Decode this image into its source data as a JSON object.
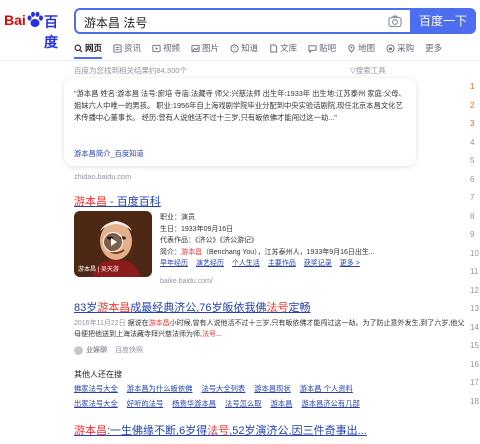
{
  "header": {
    "logo_left": "Bai",
    "logo_right": "百度",
    "query": "游本昌 法号",
    "search_button": "百度一下"
  },
  "tabs": [
    {
      "label": "网页",
      "icon": "search-icon",
      "active": true
    },
    {
      "label": "资讯",
      "icon": "news-icon"
    },
    {
      "label": "视频",
      "icon": "video-icon"
    },
    {
      "label": "图片",
      "icon": "image-icon"
    },
    {
      "label": "知道",
      "icon": "question-icon"
    },
    {
      "label": "文库",
      "icon": "document-icon"
    },
    {
      "label": "贴吧",
      "icon": "forum-icon"
    },
    {
      "label": "地图",
      "icon": "map-icon"
    },
    {
      "label": "采购",
      "icon": "cart-icon"
    },
    {
      "label": "更多",
      "icon": ""
    }
  ],
  "results_info": {
    "count_text": "百度为您找到相关结果约84,300个",
    "tools_text": "▽搜索工具"
  },
  "answer": {
    "text": "\"游本昌 姓名:游本昌 法号:瘀培 寺庙:法藏寺 师父:兴慈法师 出生年:1933年 出生地:江苏泰州 家庭:父母、姐妹六人中唯一的男孩。 职业:1956年自上海戏剧学院毕业分配到中央实验话剧院,现任北京本昌文化艺术传播中心董事长。 经历:曾有人说他活不过十三岁,只有皈依佛才能闯过这一劫...\"",
    "links": "游本昌简介_百度知道",
    "source": "zhidao.baidu.com"
  },
  "ranks": [
    "1",
    "2",
    "3",
    "4",
    "5",
    "6",
    "7",
    "8",
    "9",
    "10",
    "11",
    "12",
    "13",
    "14",
    "15",
    "16",
    "17",
    "18"
  ],
  "baike": {
    "title_name": "游本昌",
    "title_suffix": " - 百度百科",
    "thumb_caption": "游本昌 | 吴天游",
    "occupation": "职业：演员",
    "birthday": "生日：1933年09月16日",
    "works": "代表作品：《济公》《济公游记》",
    "intro_prefix": "简介：",
    "intro_name": "游本昌",
    "intro_rest": "（Benchang You），江苏泰州人，1933年9月16日出生...",
    "links": [
      "早年经历",
      "演艺经历",
      "个人生活",
      "主要作品",
      "获奖记录",
      "更多 >"
    ],
    "url": "baike.baidu.com/"
  },
  "article": {
    "title_pre": "83岁",
    "title_name": "游本昌",
    "title_mid": "成最经典济公,76岁皈依我佛",
    "title_hl": "法号",
    "title_post": "定畅",
    "date": "2016年11月22日",
    "snippet_a": " 据说在",
    "snippet_hl": "游本昌",
    "snippet_b": "小时候,曾有人说他活不过十三岁,只有皈依佛才能闯过这一劫。为了防止意外发生,到了六岁,他父母便把他送到上海法藏寺拜兴慈法师为师,",
    "snippet_hl2": "法号",
    "snippet_c": "...",
    "source": "业娱聊",
    "snapshot": "百度快照"
  },
  "related": {
    "heading": "其他人还在搜",
    "rows": [
      [
        "佛家法号大全",
        "游本昌为什么皈依佛",
        "法号大全列表",
        "游本昌现状",
        "游本昌 个人资料"
      ],
      [
        "出家法号大全",
        "好听的法号",
        "杨贵华游本昌",
        "法号怎么取",
        "游本昌",
        "游本昌济公有几部"
      ]
    ]
  },
  "bottom": {
    "pre": "游本昌",
    "mid": ":一生佛缘不断,6岁得",
    "hl": "法号",
    "post": ",52岁演济公,因三件奇事出..."
  },
  "colors": {
    "brand_blue": "#4e6ef2",
    "link_blue": "#2440b3",
    "highlight_red": "#f73131"
  }
}
